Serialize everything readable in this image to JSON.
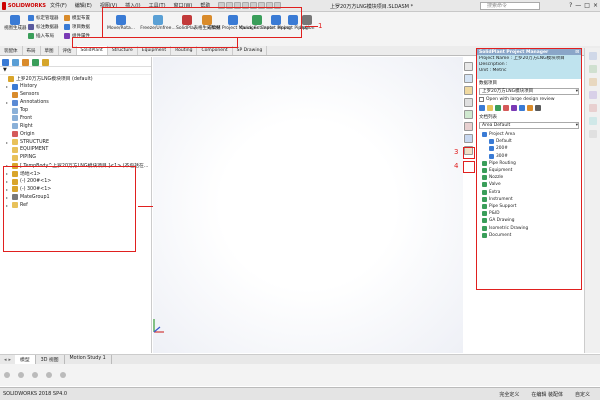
{
  "titlebar": {
    "app_name": "SOLIDWORKS",
    "menus": [
      "文件(F)",
      "编辑(E)",
      "视图(V)",
      "插入(I)",
      "工具(T)",
      "窗口(W)",
      "帮助"
    ],
    "doc_title": "上罗20万方LNG模块项目.SLDASM *",
    "search_placeholder": "搜索命令",
    "window_controls": [
      "?",
      "—",
      "□",
      "×"
    ]
  },
  "command_manager": {
    "left_buttons": [
      {
        "label": "视图生成器",
        "icon": "blue-view-icon",
        "color": "#3a7bd5"
      }
    ],
    "small_items": [
      {
        "label": "标定管理器",
        "color": "#3a7bd5"
      },
      {
        "label": "标注数据器",
        "color": "#5a5a9e"
      },
      {
        "label": "插入布局",
        "color": "#3a9e5a"
      },
      {
        "label": "模型布置",
        "color": "#d98b2b"
      },
      {
        "label": "项目数据",
        "color": "#3a7bd5"
      },
      {
        "label": "组件属性",
        "color": "#7a3ab5"
      }
    ],
    "buttons": [
      {
        "label": "Move/Rota...",
        "icon": "move-icon",
        "color": "#3a7bd5"
      },
      {
        "label": "Freeze/Unfree...",
        "icon": "freeze-icon",
        "color": "#5aa0d5"
      },
      {
        "label": "SolidPla...",
        "icon": "solidplant-icon",
        "color": "#c23a3a"
      },
      {
        "label": "表格生成数据",
        "icon": "table-icon",
        "color": "#d98b2b"
      },
      {
        "label": "ePDM Project Manager",
        "icon": "epdm-icon",
        "color": "#3a7bd5"
      },
      {
        "label": "Quick Estimate",
        "icon": "estimate-icon",
        "color": "#3a9e5a"
      },
      {
        "label": "Export Piping",
        "icon": "export-icon",
        "color": "#3a7bd5"
      },
      {
        "label": "Import Piping",
        "icon": "import-icon",
        "color": "#3a7bd5"
      },
      {
        "label": "Option",
        "icon": "gear-icon",
        "color": "#777777"
      }
    ],
    "annotation_1": "1"
  },
  "tabs": [
    "装配体",
    "布局",
    "草图",
    "评估",
    "SolidPlant",
    "Structure",
    "Equipment",
    "Routing",
    "Component",
    "SP Drawing"
  ],
  "active_tab_index": 4,
  "feature_tree": {
    "filter_label": "▼",
    "items": [
      {
        "label": "上罗20万方LNG模块项目 (default)",
        "icon": "assembly-icon",
        "color": "#d9a52b",
        "arrow": ""
      },
      {
        "label": "History",
        "icon": "history-icon",
        "color": "#3a7bd5",
        "arrow": "▸"
      },
      {
        "label": "Sensors",
        "icon": "sensor-icon",
        "color": "#d98b2b",
        "arrow": ""
      },
      {
        "label": "Annotations",
        "icon": "annotation-icon",
        "color": "#5a8ad5",
        "arrow": "▸"
      },
      {
        "label": "Top",
        "icon": "plane-icon",
        "color": "#8ab0d8",
        "arrow": ""
      },
      {
        "label": "Front",
        "icon": "plane-icon",
        "color": "#8ab0d8",
        "arrow": ""
      },
      {
        "label": "Right",
        "icon": "plane-icon",
        "color": "#8ab0d8",
        "arrow": ""
      },
      {
        "label": "Origin",
        "icon": "origin-icon",
        "color": "#d55a5a",
        "arrow": ""
      },
      {
        "label": "STRUCTURE",
        "icon": "folder-icon",
        "color": "#e8c15a",
        "arrow": "▸"
      },
      {
        "label": "EQUIPMENT",
        "icon": "folder-icon",
        "color": "#e8c15a",
        "arrow": ""
      },
      {
        "label": "PIPING",
        "icon": "folder-icon",
        "color": "#e8c15a",
        "arrow": ""
      },
      {
        "label": "[ TempBody^上罗20万方LNG模块项目 ]<1> (不包括在...",
        "icon": "part-icon",
        "color": "#d9a52b",
        "arrow": "▸"
      },
      {
        "label": "场地<1>",
        "icon": "part-icon",
        "color": "#d9a52b",
        "arrow": "▸"
      },
      {
        "label": "(-) 200#<1>",
        "icon": "part-icon",
        "color": "#d9a52b",
        "arrow": "▸"
      },
      {
        "label": "(-) 300#<1>",
        "icon": "part-icon",
        "color": "#d9a52b",
        "arrow": "▸"
      },
      {
        "label": "MateGroup1",
        "icon": "mate-icon",
        "color": "#7a7a7a",
        "arrow": "▸"
      },
      {
        "label": "Ref",
        "icon": "folder-icon",
        "color": "#e8c15a",
        "arrow": "▸"
      }
    ],
    "annotation_2": "2"
  },
  "side_icons": {
    "annotation_3": "3",
    "annotation_4": "4"
  },
  "project_manager": {
    "title": "SolidPlant Project Manager",
    "info": [
      "Project Name : 上罗20万方LNG模块项目",
      "Description :",
      "Unit : Metric"
    ],
    "section_label": "数据项目",
    "selected_project": "上罗20万方LNG模块项目",
    "checkbox_label": "Open with large design review",
    "doc_section_label": "文档列表",
    "area_label": "Area",
    "area_value": "Default",
    "tree": [
      {
        "label": "Project Area",
        "indent": 0,
        "color": "#3a7bd5"
      },
      {
        "label": "Default",
        "indent": 1,
        "color": "#3a7bd5"
      },
      {
        "label": "200#",
        "indent": 1,
        "color": "#3a7bd5"
      },
      {
        "label": "300#",
        "indent": 1,
        "color": "#3a7bd5"
      },
      {
        "label": "Pipe Routing",
        "indent": 0,
        "color": "#3a9e5a"
      },
      {
        "label": "Equipment",
        "indent": 0,
        "color": "#3a9e5a"
      },
      {
        "label": "Nozzle",
        "indent": 0,
        "color": "#3a9e5a"
      },
      {
        "label": "Valve",
        "indent": 0,
        "color": "#3a9e5a"
      },
      {
        "label": "Extra",
        "indent": 0,
        "color": "#3a9e5a"
      },
      {
        "label": "Instrument",
        "indent": 0,
        "color": "#3a9e5a"
      },
      {
        "label": "Pipe Support",
        "indent": 0,
        "color": "#3a9e5a"
      },
      {
        "label": "P&ID",
        "indent": 0,
        "color": "#3a9e5a"
      },
      {
        "label": "GA Drawing",
        "indent": 0,
        "color": "#3a9e5a"
      },
      {
        "label": "Isometric Drawing",
        "indent": 0,
        "color": "#3a9e5a"
      },
      {
        "label": "Document",
        "indent": 0,
        "color": "#3a9e5a"
      }
    ]
  },
  "bottom_tabs": [
    "模型",
    "3D 视图",
    "Motion Study 1"
  ],
  "status_bar": {
    "left": "SOLIDWORKS 2018 SP4.0",
    "right": [
      "完全定义",
      "在编辑 装配体",
      "自定义"
    ]
  },
  "colors": {
    "annotation_red": "#e0201f",
    "panel_header": "#8aa6c8",
    "info_bg": "#bfe3ee"
  }
}
